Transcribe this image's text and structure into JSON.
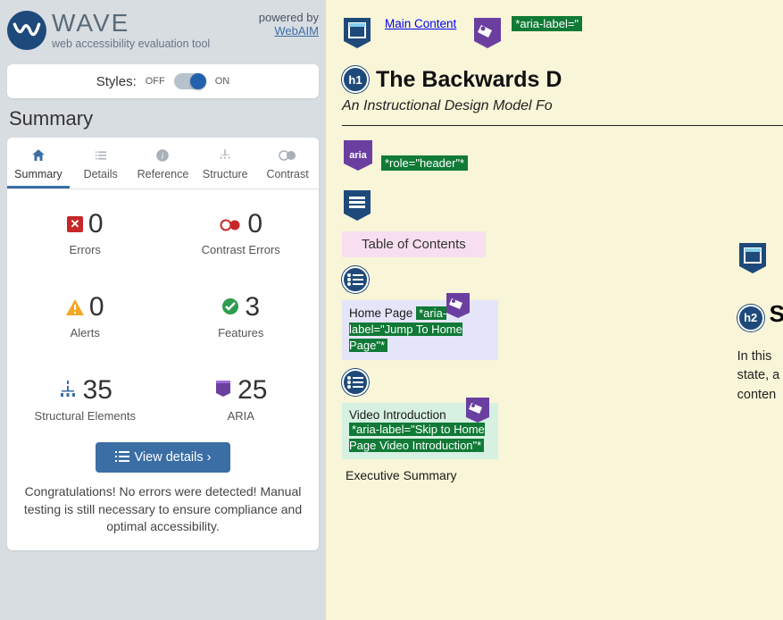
{
  "brand": {
    "title": "WAVE",
    "subtitle": "web accessibility evaluation tool"
  },
  "powered": {
    "label": "powered by",
    "link": "WebAIM"
  },
  "styles": {
    "label": "Styles:",
    "off": "OFF",
    "on": "ON"
  },
  "section_title": "Summary",
  "tabs": {
    "summary": "Summary",
    "details": "Details",
    "reference": "Reference",
    "structure": "Structure",
    "contrast": "Contrast"
  },
  "stats": {
    "errors": {
      "value": "0",
      "label": "Errors"
    },
    "contrast": {
      "value": "0",
      "label": "Contrast Errors"
    },
    "alerts": {
      "value": "0",
      "label": "Alerts"
    },
    "features": {
      "value": "3",
      "label": "Features"
    },
    "structural": {
      "value": "35",
      "label": "Structural Elements"
    },
    "aria": {
      "value": "25",
      "label": "ARIA"
    }
  },
  "view_details": "View details ›",
  "congrats": "Congratulations! No errors were detected! Manual testing is still necessary to ensure compliance and optimal accessibility.",
  "page": {
    "main_content_link": "Main Content",
    "aria_label_top": "*aria-label=\"",
    "h1": "The Backwards D",
    "subtitle": "An Instructional Design Model Fo",
    "role_header": "*role=\"header\"*",
    "toc": "Table of Contents",
    "home_page": "Home Page",
    "aria_jump": "*aria-label=\"Jump To Home Page\"*",
    "video_intro": "Video Introduction",
    "aria_video": "*aria-label=\"Skip to Home Page Video Introduction\"*",
    "exec_summary": "Executive Summary",
    "right_para": "In this state, a conten"
  }
}
